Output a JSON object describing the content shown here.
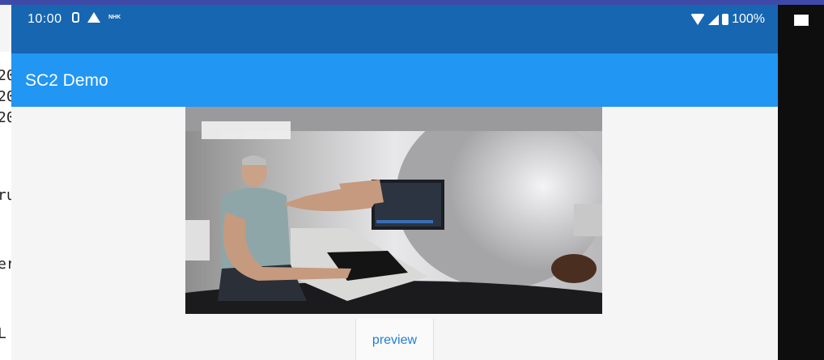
{
  "status_bar": {
    "time": "10:00",
    "battery": "100%",
    "icons_left": [
      "sim-icon",
      "drive-icon",
      "nhk-icon"
    ],
    "icons_right": [
      "wifi-icon",
      "signal-icon",
      "battery-icon"
    ],
    "nhk_label": "NHK"
  },
  "app_bar": {
    "title": "SC2 Demo"
  },
  "video": {
    "description_icon": "video-preview-frame"
  },
  "actions": {
    "preview_label": "preview"
  },
  "terminal": {
    "lines": [
      "20",
      "20",
      "20",
      "ru",
      "er",
      "L"
    ]
  },
  "colors": {
    "status_bar": "#1666b2",
    "app_bar": "#2196f3",
    "button_text": "#1e7fd6",
    "background": "#f5f5f5"
  }
}
